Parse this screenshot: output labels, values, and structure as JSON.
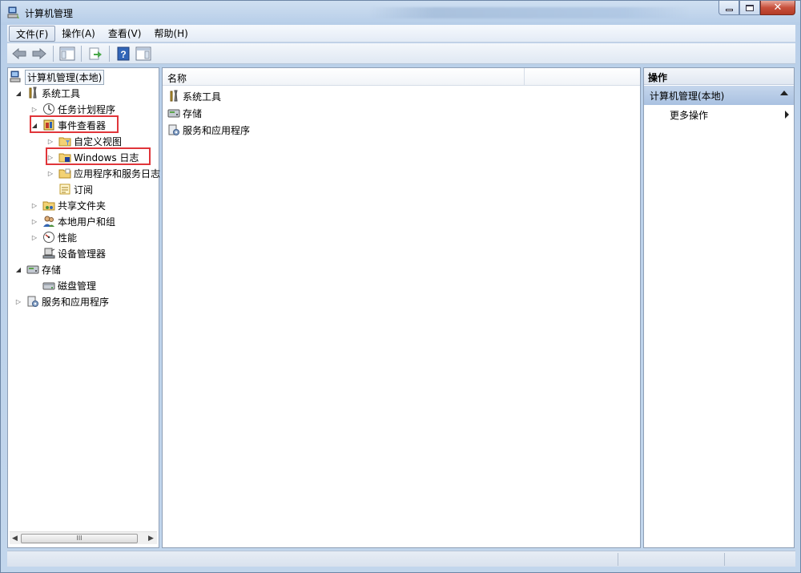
{
  "window": {
    "title": "计算机管理"
  },
  "menubar": {
    "items": [
      "文件(F)",
      "操作(A)",
      "查看(V)",
      "帮助(H)"
    ]
  },
  "tree": {
    "root": "计算机管理(本地)",
    "items": [
      {
        "label": "系统工具",
        "expanded": true
      },
      {
        "label": "任务计划程序"
      },
      {
        "label": "事件查看器",
        "expanded": true,
        "highlighted": true
      },
      {
        "label": "自定义视图"
      },
      {
        "label": "Windows 日志",
        "highlighted": true
      },
      {
        "label": "应用程序和服务日志"
      },
      {
        "label": "订阅"
      },
      {
        "label": "共享文件夹"
      },
      {
        "label": "本地用户和组"
      },
      {
        "label": "性能"
      },
      {
        "label": "设备管理器"
      },
      {
        "label": "存储",
        "expanded": true
      },
      {
        "label": "磁盘管理"
      },
      {
        "label": "服务和应用程序"
      }
    ],
    "scroll_thumb": "III"
  },
  "list": {
    "column_name": "名称",
    "rows": [
      "系统工具",
      "存储",
      "服务和应用程序"
    ]
  },
  "actions": {
    "header": "操作",
    "section": "计算机管理(本地)",
    "more": "更多操作"
  },
  "colors": {
    "highlight": "#e0353a",
    "section_bg": "#b7cbe6"
  }
}
